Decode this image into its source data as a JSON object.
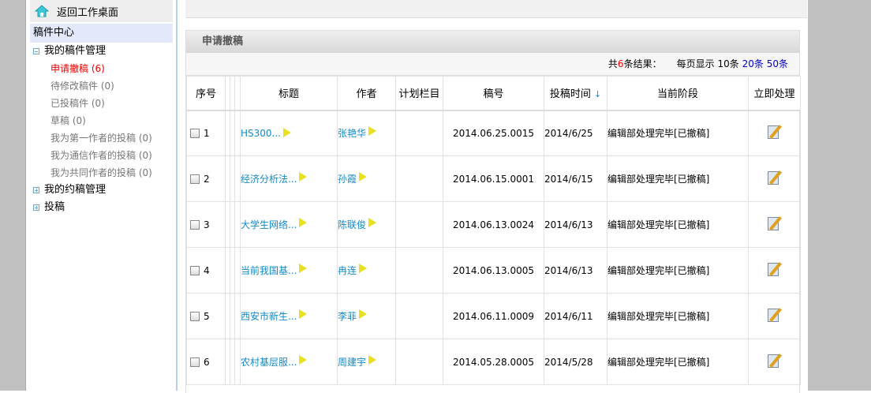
{
  "sidebar": {
    "home": "返回工作桌面",
    "center": "稿件中心",
    "groups": [
      {
        "label": "我的稿件管理"
      },
      {
        "label": "我的约稿管理"
      },
      {
        "label": "投稿"
      }
    ],
    "items": [
      {
        "label": "申请撤稿 (6)"
      },
      {
        "label": "待修改稿件 (0)"
      },
      {
        "label": "已投稿件 (0)"
      },
      {
        "label": "草稿 (0)"
      },
      {
        "label": "我为第一作者的投稿 (0)"
      },
      {
        "label": "我为通信作者的投稿 (0)"
      },
      {
        "label": "我为共同作者的投稿 (0)"
      }
    ]
  },
  "panel": {
    "title": "申请撤稿",
    "total_prefix": "共",
    "total": "6",
    "total_suffix": "条结果：",
    "per_page": "每页显示",
    "opt10": "10条",
    "opt20": "20条",
    "opt50": "50条"
  },
  "columns": [
    "序号",
    "标题",
    "作者",
    "计划栏目",
    "稿号",
    "投稿时间",
    "当前阶段",
    "立即处理"
  ],
  "sort_icon": "↓",
  "rows": [
    {
      "no": "1",
      "title": "HS300...",
      "author": "张艳华",
      "plan": "",
      "code": "2014.06.25.0015",
      "date": "2014/6/25",
      "stage": "编辑部处理完毕[已撤稿]"
    },
    {
      "no": "2",
      "title": "经济分析法...",
      "author": "孙霞",
      "plan": "",
      "code": "2014.06.15.0001",
      "date": "2014/6/15",
      "stage": "编辑部处理完毕[已撤稿]"
    },
    {
      "no": "3",
      "title": "大学生网络...",
      "author": "陈联俊",
      "plan": "",
      "code": "2014.06.13.0024",
      "date": "2014/6/13",
      "stage": "编辑部处理完毕[已撤稿]"
    },
    {
      "no": "4",
      "title": "当前我国基...",
      "author": "冉连",
      "plan": "",
      "code": "2014.06.13.0005",
      "date": "2014/6/13",
      "stage": "编辑部处理完毕[已撤稿]"
    },
    {
      "no": "5",
      "title": "西安市新生...",
      "author": "李菲",
      "plan": "",
      "code": "2014.06.11.0009",
      "date": "2014/6/11",
      "stage": "编辑部处理完毕[已撤稿]"
    },
    {
      "no": "6",
      "title": "农村基层服...",
      "author": "周建宇",
      "plan": "",
      "code": "2014.05.28.0005",
      "date": "2014/5/28",
      "stage": "编辑部处理完毕[已撤稿]"
    }
  ]
}
